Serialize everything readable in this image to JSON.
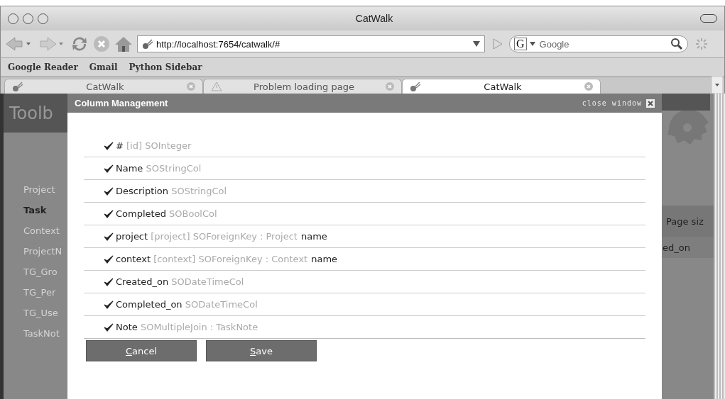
{
  "window": {
    "title": "CatWalk"
  },
  "toolbar": {
    "url": "http://localhost:7654/catwalk/#",
    "search_engine": "G",
    "search_placeholder": "Google"
  },
  "bookmarks": [
    "Google Reader",
    "Gmail",
    "Python Sidebar"
  ],
  "tabs": [
    {
      "label": "CatWalk",
      "kind": "site",
      "selected": false
    },
    {
      "label": "Problem loading page",
      "kind": "error",
      "selected": false
    },
    {
      "label": "CatWalk",
      "kind": "site",
      "selected": true
    }
  ],
  "page": {
    "header": "Toolb",
    "sidebar": [
      {
        "label": "Project",
        "selected": false
      },
      {
        "label": "Task",
        "selected": true
      },
      {
        "label": "Context",
        "selected": false
      },
      {
        "label": "ProjectN",
        "selected": false
      },
      {
        "label": "TG_Gro",
        "selected": false
      },
      {
        "label": "TG_Per",
        "selected": false
      },
      {
        "label": "TG_Use",
        "selected": false
      },
      {
        "label": "TaskNot",
        "selected": false
      }
    ],
    "right_header": "Page siz",
    "right_cell": "ed_on"
  },
  "dialog": {
    "title": "Column Management",
    "close": "close window",
    "columns": [
      {
        "name": "#",
        "type": "[id] SOInteger",
        "checked": true
      },
      {
        "name": "Name",
        "type": "SOStringCol",
        "checked": true
      },
      {
        "name": "Description",
        "type": "SOStringCol",
        "checked": true
      },
      {
        "name": "Completed",
        "type": "SOBoolCol",
        "checked": true
      },
      {
        "name": "project",
        "type": "[project] SOForeignKey : Project",
        "extra": "name",
        "checked": true
      },
      {
        "name": "context",
        "type": "[context] SOForeignKey : Context",
        "extra": "name",
        "checked": true
      },
      {
        "name": "Created_on",
        "type": "SODateTimeCol",
        "checked": true
      },
      {
        "name": "Completed_on",
        "type": "SODateTimeCol",
        "checked": true
      },
      {
        "name": "Note",
        "type": "SOMultipleJoin : TaskNote",
        "checked": true
      }
    ],
    "buttons": [
      "Cancel",
      "Save"
    ]
  }
}
